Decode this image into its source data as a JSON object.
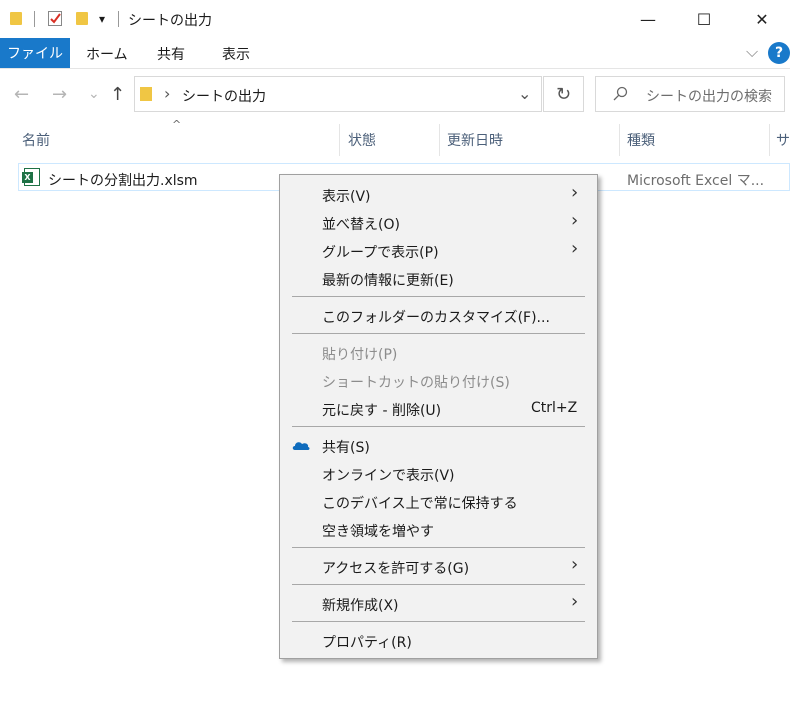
{
  "titlebar": {
    "title": "シートの出力",
    "quick_access_dropdown": "▾",
    "minimize": "—",
    "maximize": "☐",
    "close": "✕"
  },
  "ribbon": {
    "tabs": [
      "ファイル",
      "ホーム",
      "共有",
      "表示"
    ],
    "expand": "⌵",
    "help": "?"
  },
  "navigation": {
    "back": "←",
    "forward": "→",
    "recent": "⌄",
    "up": "↑"
  },
  "address": {
    "chevron": "›",
    "path": "シートの出力",
    "dropdown": "⌄",
    "refresh": "↻"
  },
  "search": {
    "placeholder": "シートの出力の検索"
  },
  "columns": {
    "name": "名前",
    "status": "状態",
    "date": "更新日時",
    "type": "種類",
    "size": "サ"
  },
  "file": {
    "name": "シートの分割出力.xlsm",
    "type": "Microsoft Excel マ..."
  },
  "context_menu": {
    "view": "表示(V)",
    "sort": "並べ替え(O)",
    "group": "グループで表示(P)",
    "refresh": "最新の情報に更新(E)",
    "customize": "このフォルダーのカスタマイズ(F)...",
    "paste": "貼り付け(P)",
    "paste_shortcut": "ショートカットの貼り付け(S)",
    "undo": "元に戻す - 削除(U)",
    "undo_shortcut": "Ctrl+Z",
    "share": "共有(S)",
    "view_online": "オンラインで表示(V)",
    "keep_on_device": "このデバイス上で常に保持する",
    "free_space": "空き領域を増やす",
    "grant_access": "アクセスを許可する(G)",
    "new": "新規作成(X)",
    "properties": "プロパティ(R)",
    "submenu_arrow": "›"
  },
  "colors": {
    "accent": "#1979ca",
    "folder": "#f0c644",
    "excel": "#1e7145",
    "onedrive": "#0f6cbd"
  }
}
